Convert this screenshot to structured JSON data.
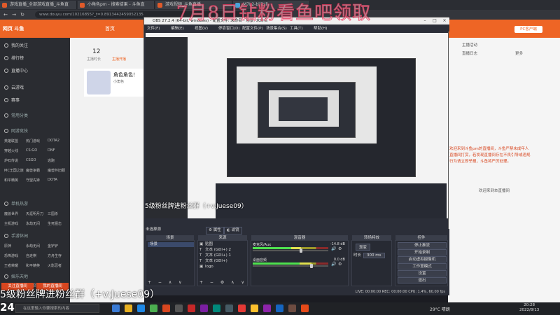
{
  "browser": {
    "tabs": [
      "游戏直播_全部游戏直播_斗鱼直",
      "小角色pm - 搜索结果 - 斗鱼直",
      "游戏视频_斗鱼直播",
      "M7L2-bilibili"
    ],
    "address": "www.douyu.com/10216855?_t=0.8913442459052135"
  },
  "douyu": {
    "logo": "网页 斗鱼",
    "home": "首页",
    "stats": [
      {
        "num": "12",
        "label": "主播时长"
      },
      {
        "num": "",
        "label": "主播开播"
      }
    ],
    "sidebar": [
      {
        "label": "我的关注",
        "head": false
      },
      {
        "label": "排行榜",
        "head": false
      },
      {
        "label": "直播中心",
        "head": false
      },
      {
        "label": "云游戏",
        "head": false
      },
      {
        "label": "赛事",
        "head": false
      },
      {
        "label": "常用分类",
        "head": true
      },
      {
        "label": "网游竞技",
        "head": true
      },
      {
        "label": "单机热游",
        "head": true
      },
      {
        "label": "手游休闲",
        "head": true
      },
      {
        "label": "娱乐天地",
        "head": true
      }
    ],
    "games": [
      "英雄联盟",
      "热门游戏",
      "DOTA2",
      "穿越火线",
      "CS:GO",
      "DNF",
      "炉石传说",
      "CSGO",
      "逃跑",
      "MC王国之旅",
      "魔兽争霸",
      "魔兽怀旧服",
      "和平精英",
      "守望先锋",
      "DOTA",
      "魔兽世界",
      "天涯明月刀",
      "三国杀",
      "主机游戏",
      "永劫无间",
      "生死狙击",
      "原神",
      "永劫无间",
      "金铲铲",
      "恐怖游戏",
      "自走棋",
      "方舟生存",
      "王者荣耀",
      "和平精英",
      "火影忍者",
      "COD手游",
      "使命召唤",
      "FF手游"
    ],
    "card_title": "角色角色！",
    "card_sub": "小角色",
    "follow_btn": "关注直播间",
    "gift_btn": "我的直播间",
    "right_title": "PC客户端",
    "right_lines": [
      {
        "text": "主播活动",
        "red": false
      },
      {
        "text": "直播日志",
        "red": false
      },
      {
        "text": "更多",
        "red": false
      },
      {
        "text": "欢迎来到斗鱼pm的直播间，斗鱼严禁未成年人",
        "red": true
      },
      {
        "text": "直播间打赏，若发现直播间存在不良引导或违规",
        "red": true
      },
      {
        "text": "行为请立即举报，斗鱼将严厉处理。",
        "red": true
      },
      {
        "text": "欢迎来到本直播间",
        "red": false
      }
    ]
  },
  "obs": {
    "title": "OBS 27.2.4 (64-bit, windows) - 配置文件: 未命名 - 场景: 未命名",
    "menu": [
      "文件(F)",
      "编辑(E)",
      "视图(V)",
      "停靠窗口(D)",
      "配置文件(P)",
      "场景集合(S)",
      "工具(T)",
      "帮助(H)"
    ],
    "no_source": "未选择源",
    "props_btn": "属性",
    "filters_btn": "滤镜",
    "docks": {
      "scenes": {
        "title": "场景",
        "items": [
          "场景"
        ]
      },
      "sources": {
        "title": "来源",
        "items": [
          {
            "glyph": "▣",
            "label": "贴图"
          },
          {
            "glyph": "T",
            "label": "文本 (GDI+) 2"
          },
          {
            "glyph": "T",
            "label": "文本 (GDI+) 1"
          },
          {
            "glyph": "T",
            "label": "文本 (GDI+)"
          },
          {
            "glyph": "▣",
            "label": "logo"
          }
        ]
      },
      "mixer": {
        "title": "混音器",
        "channels": [
          {
            "label": "麦克风/Aux",
            "db": "-14.8 dB",
            "level": 0.64
          },
          {
            "label": "桌面音频",
            "db": "0.0 dB",
            "level": 0.78
          }
        ]
      },
      "transitions": {
        "title": "转场特效",
        "type": "渐变",
        "duration_label": "时长",
        "duration": "300 ms"
      },
      "controls": {
        "title": "控件",
        "buttons": [
          "停止推流",
          "开始录制",
          "启动虚拟摄像机",
          "工作室模式",
          "设置",
          "退出"
        ]
      }
    },
    "status": "LIVE: 00:00:00   REC: 00:00:00   CPU: 1.4%, 60.00 fps"
  },
  "overlays": {
    "top": "7月8日钻粉看鱼吧领取",
    "middle": "5级粉丝牌进粉丝群（+v:Juese09）",
    "bottom": "5级粉丝牌进粉丝群（+v:Juese09）",
    "number": "24"
  },
  "taskbar": {
    "search_placeholder": "在这里输入你要搜索的内容",
    "weather": "29°C 晴朗",
    "time": "20:28",
    "date": "2022/8/13"
  },
  "colors": {
    "brand": "#ee6525",
    "obs_bg": "#2b2e38",
    "overlay_red": "#e62850"
  }
}
